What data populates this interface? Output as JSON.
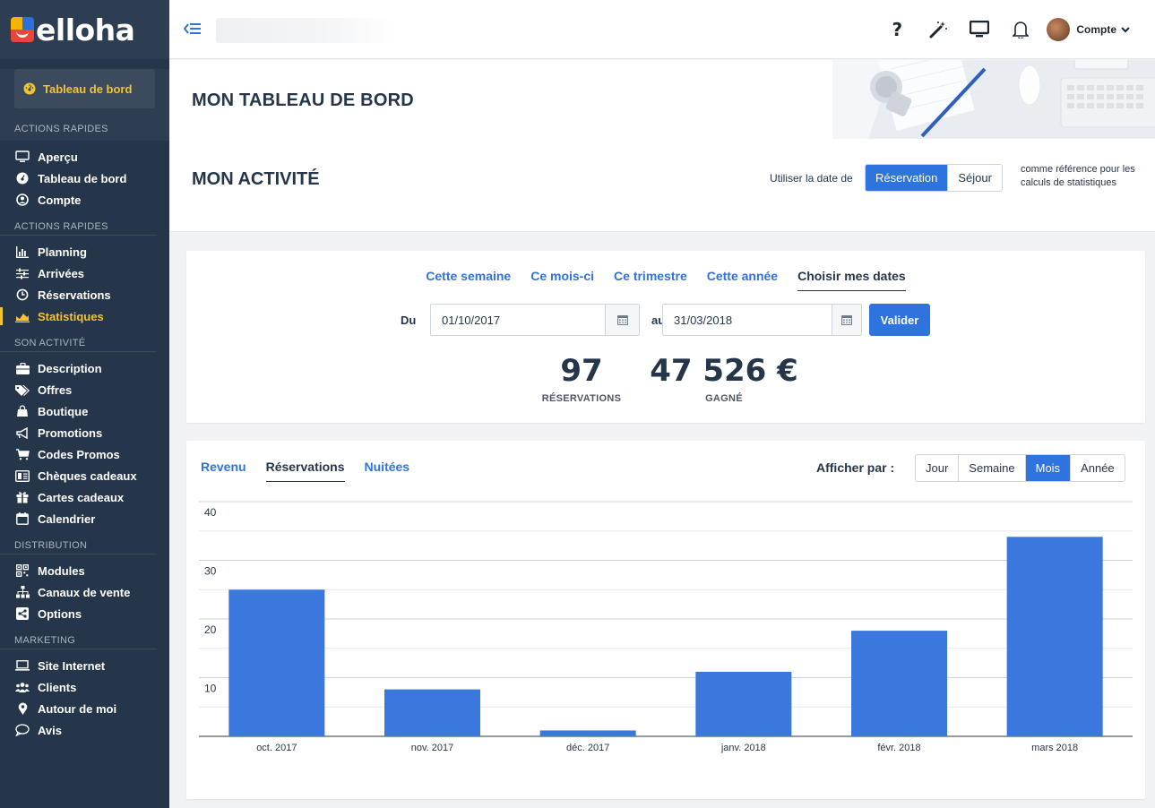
{
  "brand": {
    "name": "elloha"
  },
  "sidebar": {
    "dashboard_button": "Tableau de bord",
    "sections": [
      {
        "title": "ACTIONS RAPIDES",
        "items": [
          {
            "label": "Aperçu",
            "icon": "monitor-icon"
          },
          {
            "label": "Tableau de bord",
            "icon": "dashboard-icon"
          },
          {
            "label": "Compte",
            "icon": "user-icon"
          }
        ]
      },
      {
        "title": "ACTIONS RAPIDES",
        "items": [
          {
            "label": "Planning",
            "icon": "bar-chart-icon"
          },
          {
            "label": "Arrivées",
            "icon": "sliders-icon"
          },
          {
            "label": "Réservations",
            "icon": "clock-icon"
          },
          {
            "label": "Statistiques",
            "icon": "area-chart-icon",
            "active": true
          }
        ]
      },
      {
        "title": "SON ACTIVITÉ",
        "items": [
          {
            "label": "Description",
            "icon": "briefcase-icon"
          },
          {
            "label": "Offres",
            "icon": "tags-icon"
          },
          {
            "label": "Boutique",
            "icon": "shopping-bag-icon"
          },
          {
            "label": "Promotions",
            "icon": "megaphone-icon"
          },
          {
            "label": "Codes Promos",
            "icon": "cart-icon"
          },
          {
            "label": "Chèques cadeaux",
            "icon": "voucher-icon"
          },
          {
            "label": "Cartes cadeaux",
            "icon": "gift-icon"
          },
          {
            "label": "Calendrier",
            "icon": "calendar-icon"
          }
        ]
      },
      {
        "title": "DISTRIBUTION",
        "items": [
          {
            "label": "Modules",
            "icon": "qrcode-icon"
          },
          {
            "label": "Canaux de vente",
            "icon": "sitemap-icon"
          },
          {
            "label": "Options",
            "icon": "share-icon"
          }
        ]
      },
      {
        "title": "MARKETING",
        "items": [
          {
            "label": "Site Internet",
            "icon": "laptop-icon"
          },
          {
            "label": "Clients",
            "icon": "users-icon"
          },
          {
            "label": "Autour de moi",
            "icon": "map-marker-icon"
          },
          {
            "label": "Avis",
            "icon": "comment-icon"
          }
        ]
      }
    ]
  },
  "topbar": {
    "help_label": "?",
    "account_label": "Compte"
  },
  "page": {
    "title": "MON TABLEAU DE BORD",
    "activity_title": "MON ACTIVITÉ",
    "ref_label": "Utiliser la date de",
    "ref_options": [
      "Réservation",
      "Séjour"
    ],
    "ref_selected": 0,
    "ref_note": "comme référence pour les calculs de statistiques"
  },
  "period": {
    "tabs": [
      "Cette semaine",
      "Ce mois-ci",
      "Ce trimestre",
      "Cette année",
      "Choisir mes dates"
    ],
    "selected": 4,
    "from_label": "Du",
    "from_value": "01/10/2017",
    "to_label": "au",
    "to_value": "31/03/2018",
    "submit": "Valider"
  },
  "kpis": [
    {
      "value": "97",
      "label": "RÉSERVATIONS"
    },
    {
      "value": "47 526 €",
      "label": "GAGNÉ"
    }
  ],
  "metric_tabs": [
    "Revenu",
    "Réservations",
    "Nuitées"
  ],
  "metric_selected": 1,
  "show_by": {
    "label": "Afficher par :",
    "options": [
      "Jour",
      "Semaine",
      "Mois",
      "Année"
    ],
    "selected": 2
  },
  "colors": {
    "accent": "#2f73de",
    "sidebar": "#25364a",
    "highlight": "#f4c430"
  },
  "chart_data": {
    "type": "bar",
    "categories": [
      "oct. 2017",
      "nov. 2017",
      "déc. 2017",
      "janv. 2018",
      "févr. 2018",
      "mars 2018"
    ],
    "values": [
      25,
      8,
      1,
      11,
      18,
      34
    ],
    "ylim": [
      0,
      40
    ],
    "yticks": [
      10,
      20,
      30,
      40
    ],
    "grid": true,
    "color": "#3a78dd"
  }
}
